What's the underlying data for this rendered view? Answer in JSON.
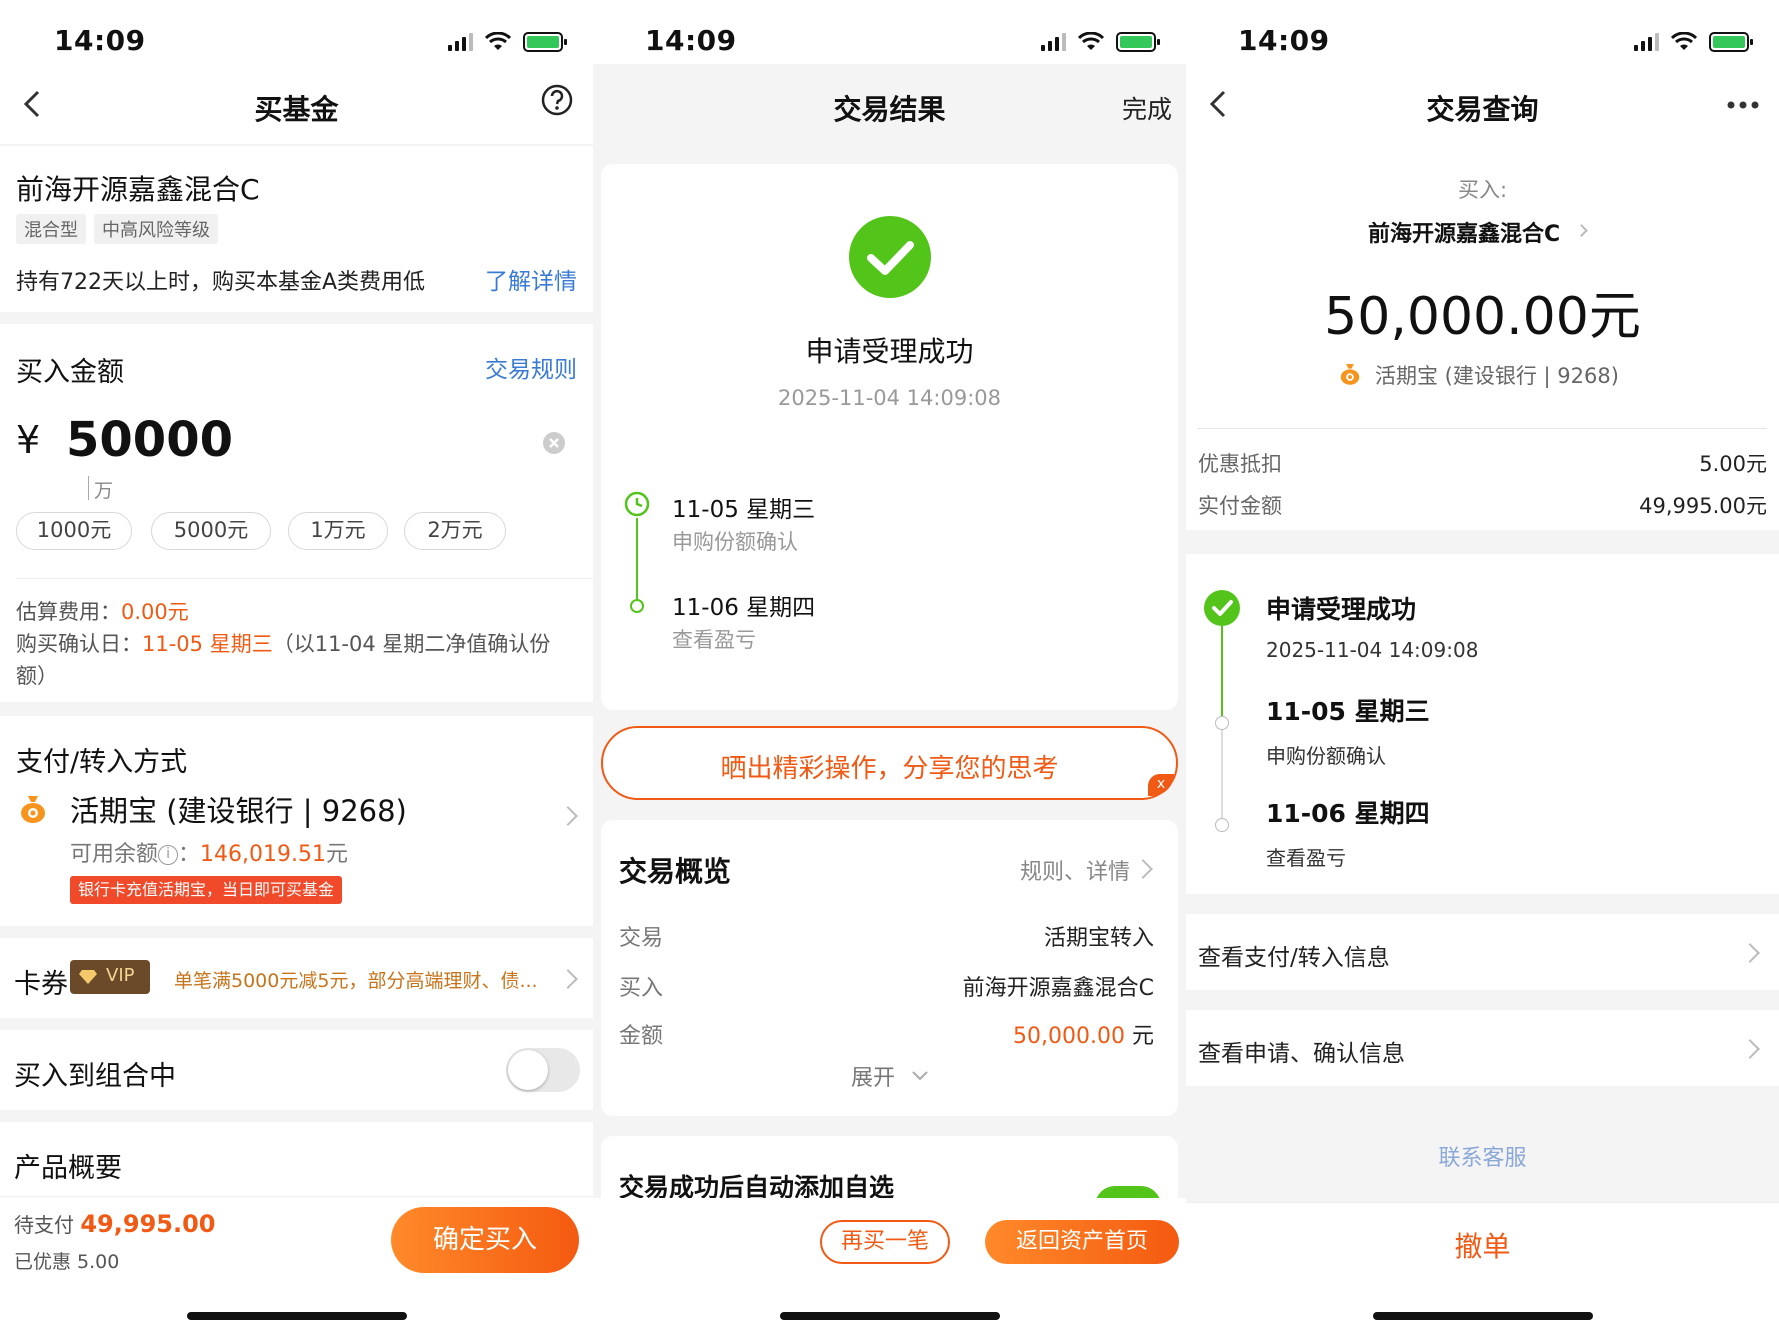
{
  "status_time": "14:09",
  "buy": {
    "title": "买基金",
    "fund_name": "前海开源嘉鑫混合C",
    "tags": [
      "混合型",
      "中高风险等级"
    ],
    "notice": "持有722天以上时，购买本基金A类费用低",
    "notice_link": "了解详情",
    "amount_label": "买入金额",
    "rules_link": "交易规则",
    "currency": "¥",
    "amount": "50000",
    "unit_hint": "万",
    "quick_amounts": [
      "1000元",
      "5000元",
      "1万元",
      "2万元"
    ],
    "fee_label": "估算费用：",
    "fee_value": "0.00元",
    "confirm_label": "购买确认日：",
    "confirm_value": "11-05 星期三",
    "confirm_note": "（以11-04 星期二净值确认份",
    "confirm_note2": "额）",
    "pay_section": "支付/转入方式",
    "pay_method": "活期宝 (建设银行 | 9268)",
    "balance_label": "可用余额",
    "balance_sep": "：",
    "balance_value": "146,019.51",
    "balance_unit": "元",
    "pay_promo": "银行卡充值活期宝，当日即可买基金",
    "coupon_label": "卡券",
    "vip": "VIP",
    "coupon_text": "单笔满5000元减5元，部分高端理财、债...",
    "portfolio_label": "买入到组合中",
    "overview_label": "产品概要",
    "to_pay_label": "待支付",
    "to_pay_value": "49,995.00",
    "discount": "已优惠 5.00",
    "confirm_button": "确定买入"
  },
  "result": {
    "title": "交易结果",
    "done": "完成",
    "success": "申请受理成功",
    "datetime": "2025-11-04 14:09:08",
    "timeline": [
      {
        "date": "11-05  星期三",
        "desc": "申购份额确认"
      },
      {
        "date": "11-06  星期四",
        "desc": "查看盈亏"
      }
    ],
    "share_banner": "晒出精彩操作，分享您的思考",
    "share_close": "x",
    "overview_title": "交易概览",
    "overview_link": "规则、详情",
    "rows": [
      {
        "label": "交易",
        "value": "活期宝转入"
      },
      {
        "label": "买入",
        "value": "前海开源嘉鑫混合C"
      },
      {
        "label": "金额",
        "value": "50,000.00",
        "unit": "元"
      }
    ],
    "expand": "展开",
    "auto_add": "交易成功后自动添加自选",
    "buy_again": "再买一笔",
    "back_home": "返回资产首页"
  },
  "query": {
    "title": "交易查询",
    "buy_label": "买入:",
    "fund_name": "前海开源嘉鑫混合C",
    "amount": "50,000.00元",
    "pay_method": "活期宝 (建设银行 | 9268)",
    "discount_label": "优惠抵扣",
    "discount_value": "5.00元",
    "paid_label": "实付金额",
    "paid_value": "49,995.00元",
    "steps": [
      {
        "title": "申请受理成功",
        "desc": "2025-11-04 14:09:08"
      },
      {
        "title": "11-05 星期三",
        "desc": "申购份额确认"
      },
      {
        "title": "11-06 星期四",
        "desc": "查看盈亏"
      }
    ],
    "link1": "查看支付/转入信息",
    "link2": "查看申请、确认信息",
    "service": "联系客服",
    "cancel": "撤单"
  },
  "colors": {
    "accent": "#f05a14",
    "link": "#3a7bd5",
    "success": "#52c41a"
  }
}
